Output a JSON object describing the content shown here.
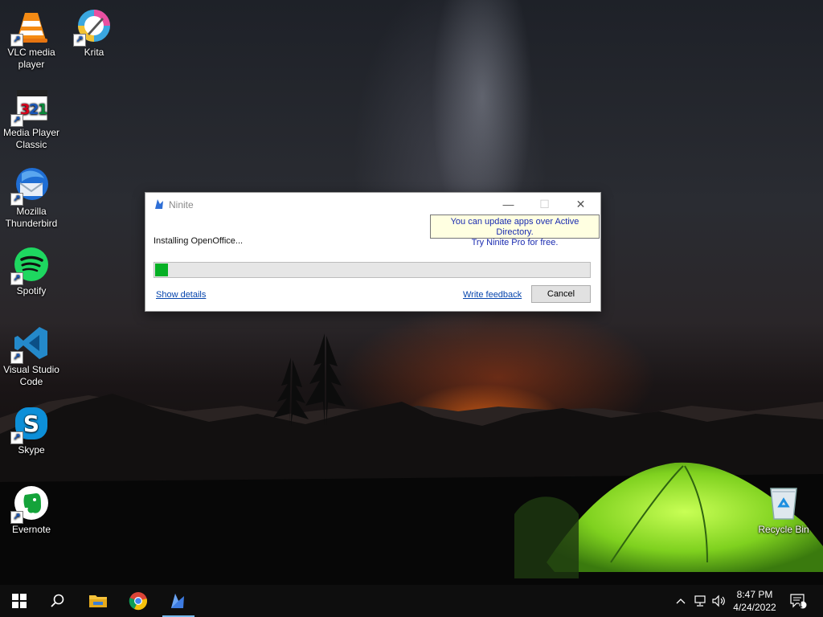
{
  "desktop": {
    "icons": [
      {
        "label": "VLC media player",
        "icon": "vlc-icon"
      },
      {
        "label": "Krita",
        "icon": "krita-icon"
      },
      {
        "label": "Media Player Classic",
        "icon": "mpc-icon"
      },
      {
        "label": "Mozilla Thunderbird",
        "icon": "thunderbird-icon"
      },
      {
        "label": "Spotify",
        "icon": "spotify-icon"
      },
      {
        "label": "Visual Studio Code",
        "icon": "vscode-icon"
      },
      {
        "label": "Skype",
        "icon": "skype-icon"
      },
      {
        "label": "Evernote",
        "icon": "evernote-icon"
      },
      {
        "label": "Recycle Bin",
        "icon": "recycle-bin-icon"
      }
    ]
  },
  "dialog": {
    "title": "Ninite",
    "tooltip_line1": "You can update apps over Active Directory.",
    "tooltip_line2": "Try Ninite Pro for free.",
    "status": "Installing OpenOffice...",
    "progress_fraction": 0.03,
    "show_details": "Show details",
    "write_feedback": "Write feedback",
    "cancel": "Cancel",
    "minimize_glyph": "—",
    "maximize_glyph": "☐",
    "close_glyph": "✕"
  },
  "taskbar": {
    "time": "8:47 PM",
    "date": "4/24/2022",
    "notification_count": "1",
    "accent": "#76b9ed"
  }
}
